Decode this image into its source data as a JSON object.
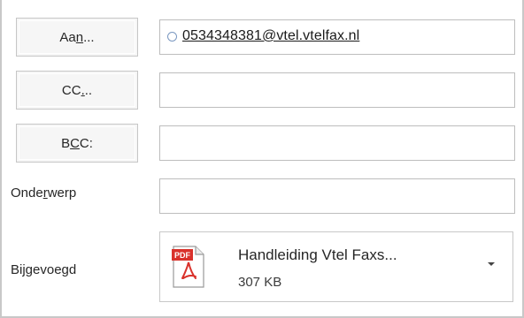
{
  "to": {
    "button_pre": "Aa",
    "button_key": "n",
    "button_post": "...",
    "recipient": "0534348381@vtel.vtelfax.nl"
  },
  "cc": {
    "button_pre": "CC",
    "button_key": ".",
    "button_post": "..",
    "value": ""
  },
  "bcc": {
    "button_pre": "B",
    "button_key": "C",
    "button_post": "C:",
    "value": ""
  },
  "subject": {
    "label_pre": "Onde",
    "label_key": "r",
    "label_post": "werp",
    "value": ""
  },
  "attachments": {
    "label": "Bijgevoegd",
    "items": [
      {
        "icon": "pdf-icon",
        "icon_text": "PDF",
        "name": "Handleiding Vtel Faxs...",
        "size": "307 KB"
      }
    ]
  },
  "colors": {
    "pdf_red": "#d9312b",
    "button_bg": "#f6f6f6",
    "border": "#c6c6c6"
  }
}
